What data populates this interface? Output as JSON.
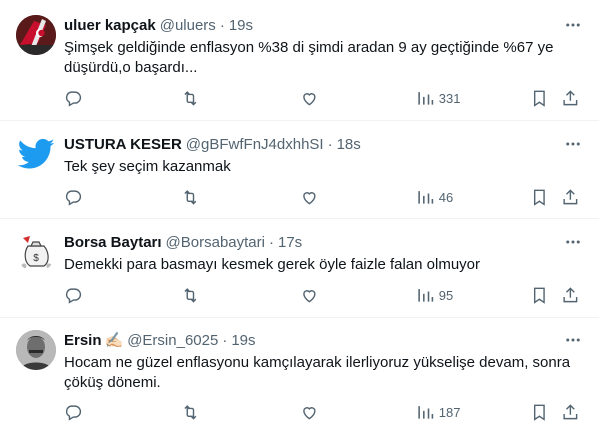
{
  "colors": {
    "text": "#0f1419",
    "muted": "#536471",
    "divider": "#eff3f4",
    "twitter_blue": "#1d9bf0"
  },
  "tweets": [
    {
      "name": "uluer kapçak",
      "handle": "@uluers",
      "sep": "·",
      "time": "19s",
      "text": "Şimşek geldiğinde enflasyon %38 di şimdi aradan 9 ay geçtiğinde  %67 ye düşürdü,o başardı...",
      "views": "331",
      "avatar_icon": "flag-avatar"
    },
    {
      "name": "USTURA KESER",
      "handle": "@gBFwfFnJ4dxhhSI",
      "sep": "·",
      "time": "18s",
      "text": "Tek şey seçim kazanmak",
      "views": "46",
      "avatar_icon": "twitter-bird-avatar"
    },
    {
      "name": "Borsa Baytarı",
      "handle": "@Borsabaytari",
      "sep": "·",
      "time": "17s",
      "text": "Demekki para basmayı kesmek gerek öyle faizle falan olmuyor",
      "views": "95",
      "avatar_icon": "money-bag-avatar"
    },
    {
      "name": "Ersin",
      "emoji": "✍🏻",
      "handle": "@Ersin_6025",
      "sep": "·",
      "time": "19s",
      "text": "Hocam ne güzel enflasyonu kamçılayarak ilerliyoruz yükselişe devam, sonra çöküş dönemi.",
      "views": "187",
      "avatar_icon": "person-photo-avatar"
    }
  ]
}
